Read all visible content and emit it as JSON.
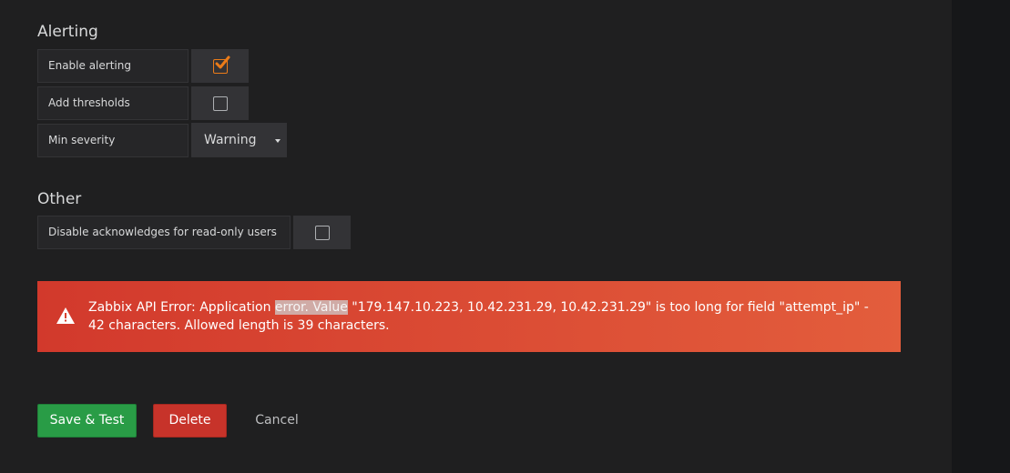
{
  "alerting": {
    "title": "Alerting",
    "enable_alerting": {
      "label": "Enable alerting",
      "checked": true
    },
    "add_thresholds": {
      "label": "Add thresholds",
      "checked": false
    },
    "min_severity": {
      "label": "Min severity",
      "value": "Warning"
    }
  },
  "other": {
    "title": "Other",
    "disable_acknowledges": {
      "label": "Disable acknowledges for read-only users",
      "checked": false
    }
  },
  "error_alert": {
    "text_before": "Zabbix API Error: Application ",
    "text_highlight": "error. Value",
    "text_after": " \"179.147.10.223, 10.42.231.29, 10.42.231.29\" is too long for field \"attempt_ip\" - 42 characters. Allowed length is 39 characters.",
    "icon": "warning-triangle-icon"
  },
  "actions": {
    "save_label": "Save & Test",
    "delete_label": "Delete",
    "cancel_label": "Cancel"
  },
  "colors": {
    "accent_checkbox": "#eb7b18",
    "save_button": "#299c46",
    "delete_button": "#c7332a",
    "alert_start": "#d2392c",
    "alert_end": "#e35d3c"
  }
}
